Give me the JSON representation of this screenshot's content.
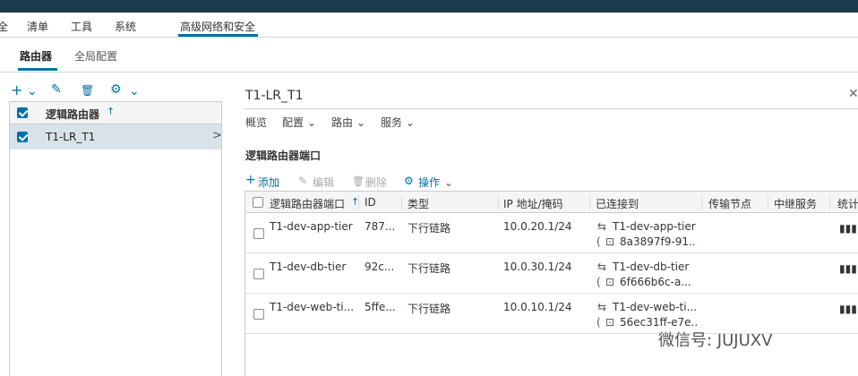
{
  "main_menu": {
    "items": [
      "全",
      "清单",
      "工具",
      "系统",
      "高级网络和安全"
    ],
    "active_index": 4
  },
  "sub_tabs": {
    "items": [
      "路由器",
      "全局配置"
    ],
    "active_index": 0
  },
  "left_toolbar": {
    "add_glyph": "+",
    "edit_glyph": "✎",
    "delete_glyph": "🗑",
    "gear_glyph": "⚙",
    "chevron": "⌄"
  },
  "left_panel": {
    "header_label": "逻辑路由器",
    "sort_glyph": "↑",
    "rows": [
      {
        "name": "T1-LR_T1",
        "selected": true
      }
    ],
    "row_chevron": ">"
  },
  "detail": {
    "title": "T1-LR_T1",
    "close_glyph": "✕",
    "tabs": [
      "概览",
      "配置",
      "路由",
      "服务"
    ],
    "tab_chevron": "⌄",
    "section_title": "逻辑路由器端口",
    "actions": {
      "add": "添加",
      "add_glyph": "+",
      "edit": "编辑",
      "edit_glyph": "✎",
      "delete": "删除",
      "delete_glyph": "🗑",
      "ops": "操作",
      "ops_glyph": "⚙"
    }
  },
  "ports_table": {
    "columns": [
      "逻辑路由器端口",
      "ID",
      "类型",
      "IP 地址/掩码",
      "已连接到",
      "传输节点",
      "中继服务",
      "统计"
    ],
    "sort_glyph": "↑",
    "rows": [
      {
        "name": "T1-dev-app-tier",
        "id": "787...",
        "type": "下行链路",
        "ip": "10.0.20.1/24",
        "connected": "T1-dev-app-tier",
        "switch_id": "8a3897f9-91...",
        "stats_icon": "▮▮▮"
      },
      {
        "name": "T1-dev-db-tier",
        "id": "92c...",
        "type": "下行链路",
        "ip": "10.0.30.1/24",
        "connected": "T1-dev-db-tier",
        "switch_id": "6f666b6c-a...",
        "stats_icon": "▮▮▮"
      },
      {
        "name": "T1-dev-web-ti...",
        "id": "5ffe...",
        "type": "下行链路",
        "ip": "10.0.10.1/24",
        "connected": "T1-dev-web-ti...",
        "switch_id": "56ec31ff-e7e...",
        "stats_icon": "▮▮▮"
      }
    ],
    "link_glyph": "⇆",
    "paren_open": "(",
    "switch_glyph": "⊡"
  },
  "watermark": "微信号: JUJUXV",
  "colors": {
    "accent": "#0072a3",
    "topbar": "#1b3a4b",
    "selected_row": "#d8e3e9"
  }
}
